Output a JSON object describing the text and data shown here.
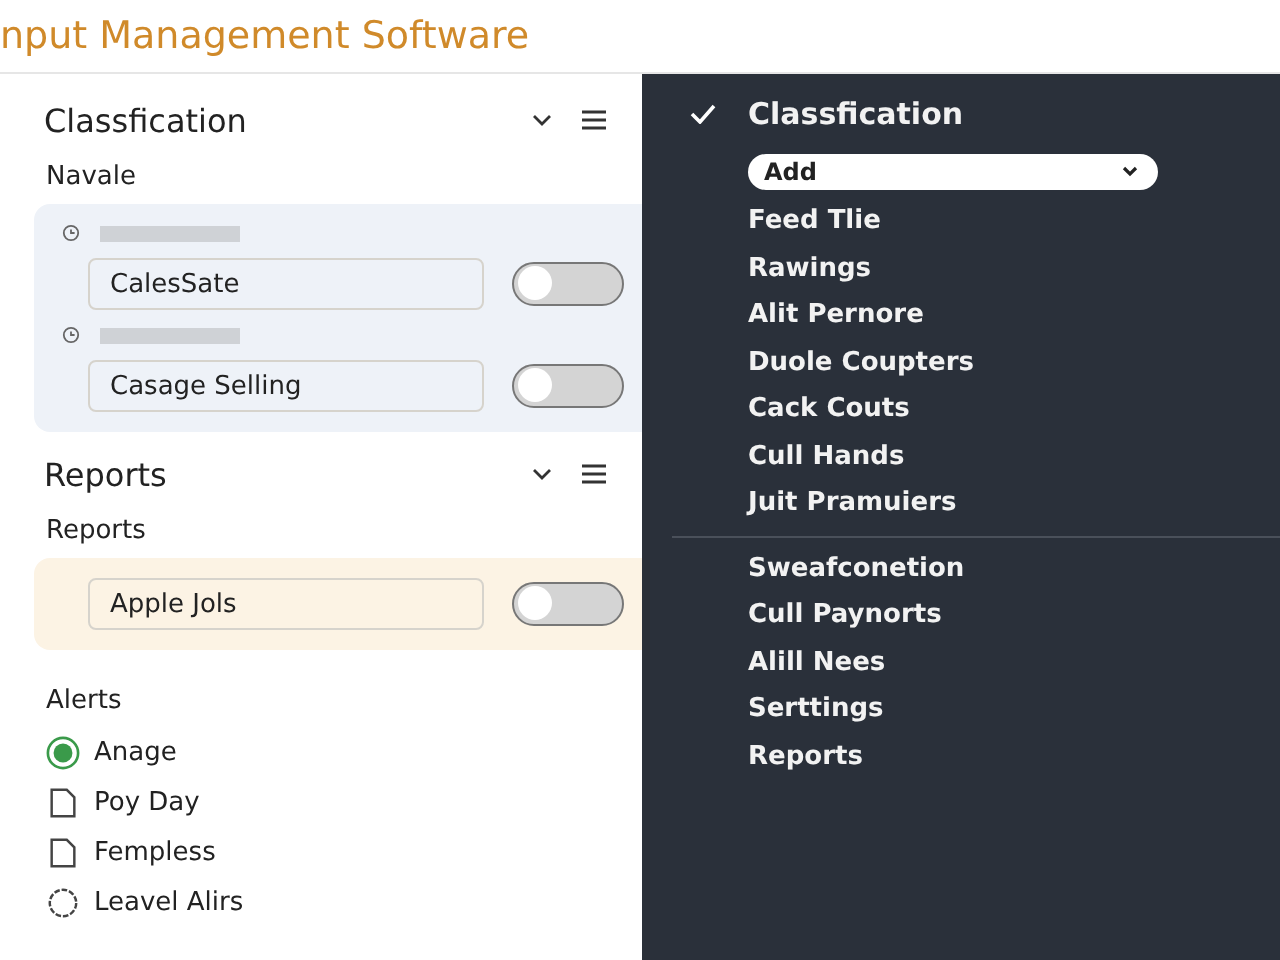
{
  "window": {
    "title": "nput Management Software"
  },
  "left_panel": {
    "sections": [
      {
        "title": "Classfication",
        "label": "Navale",
        "kind": "timed",
        "color": "#eef2f8",
        "rows": [
          {
            "field": "CalesSate",
            "on": false
          },
          {
            "field": "Casage Selling",
            "on": false
          }
        ]
      },
      {
        "title": "Reports",
        "label": "Reports",
        "kind": "plain",
        "color": "#fcf3e4",
        "rows": [
          {
            "field": "Apple Jols",
            "on": false
          }
        ]
      }
    ],
    "alerts": {
      "label": "Alerts",
      "items": [
        {
          "kind": "radio",
          "label": "Anage",
          "selected": true
        },
        {
          "kind": "document",
          "label": "Poy Day"
        },
        {
          "kind": "document",
          "label": "Fempless"
        },
        {
          "kind": "gear",
          "label": "Leavel Alirs"
        }
      ]
    }
  },
  "right_panel": {
    "title": "Classfication",
    "dropdown": {
      "value": "Add"
    },
    "groups": [
      [
        "Feed Tlie",
        "Rawings",
        "Alit Pernore",
        "Duole Coupters",
        "Cack Couts",
        "Cull Hands",
        "Juit Pramuiers"
      ],
      [
        "Sweafconetion",
        "Cull Paynorts",
        "Alill Nees",
        "Serttings",
        "Reports"
      ]
    ]
  }
}
